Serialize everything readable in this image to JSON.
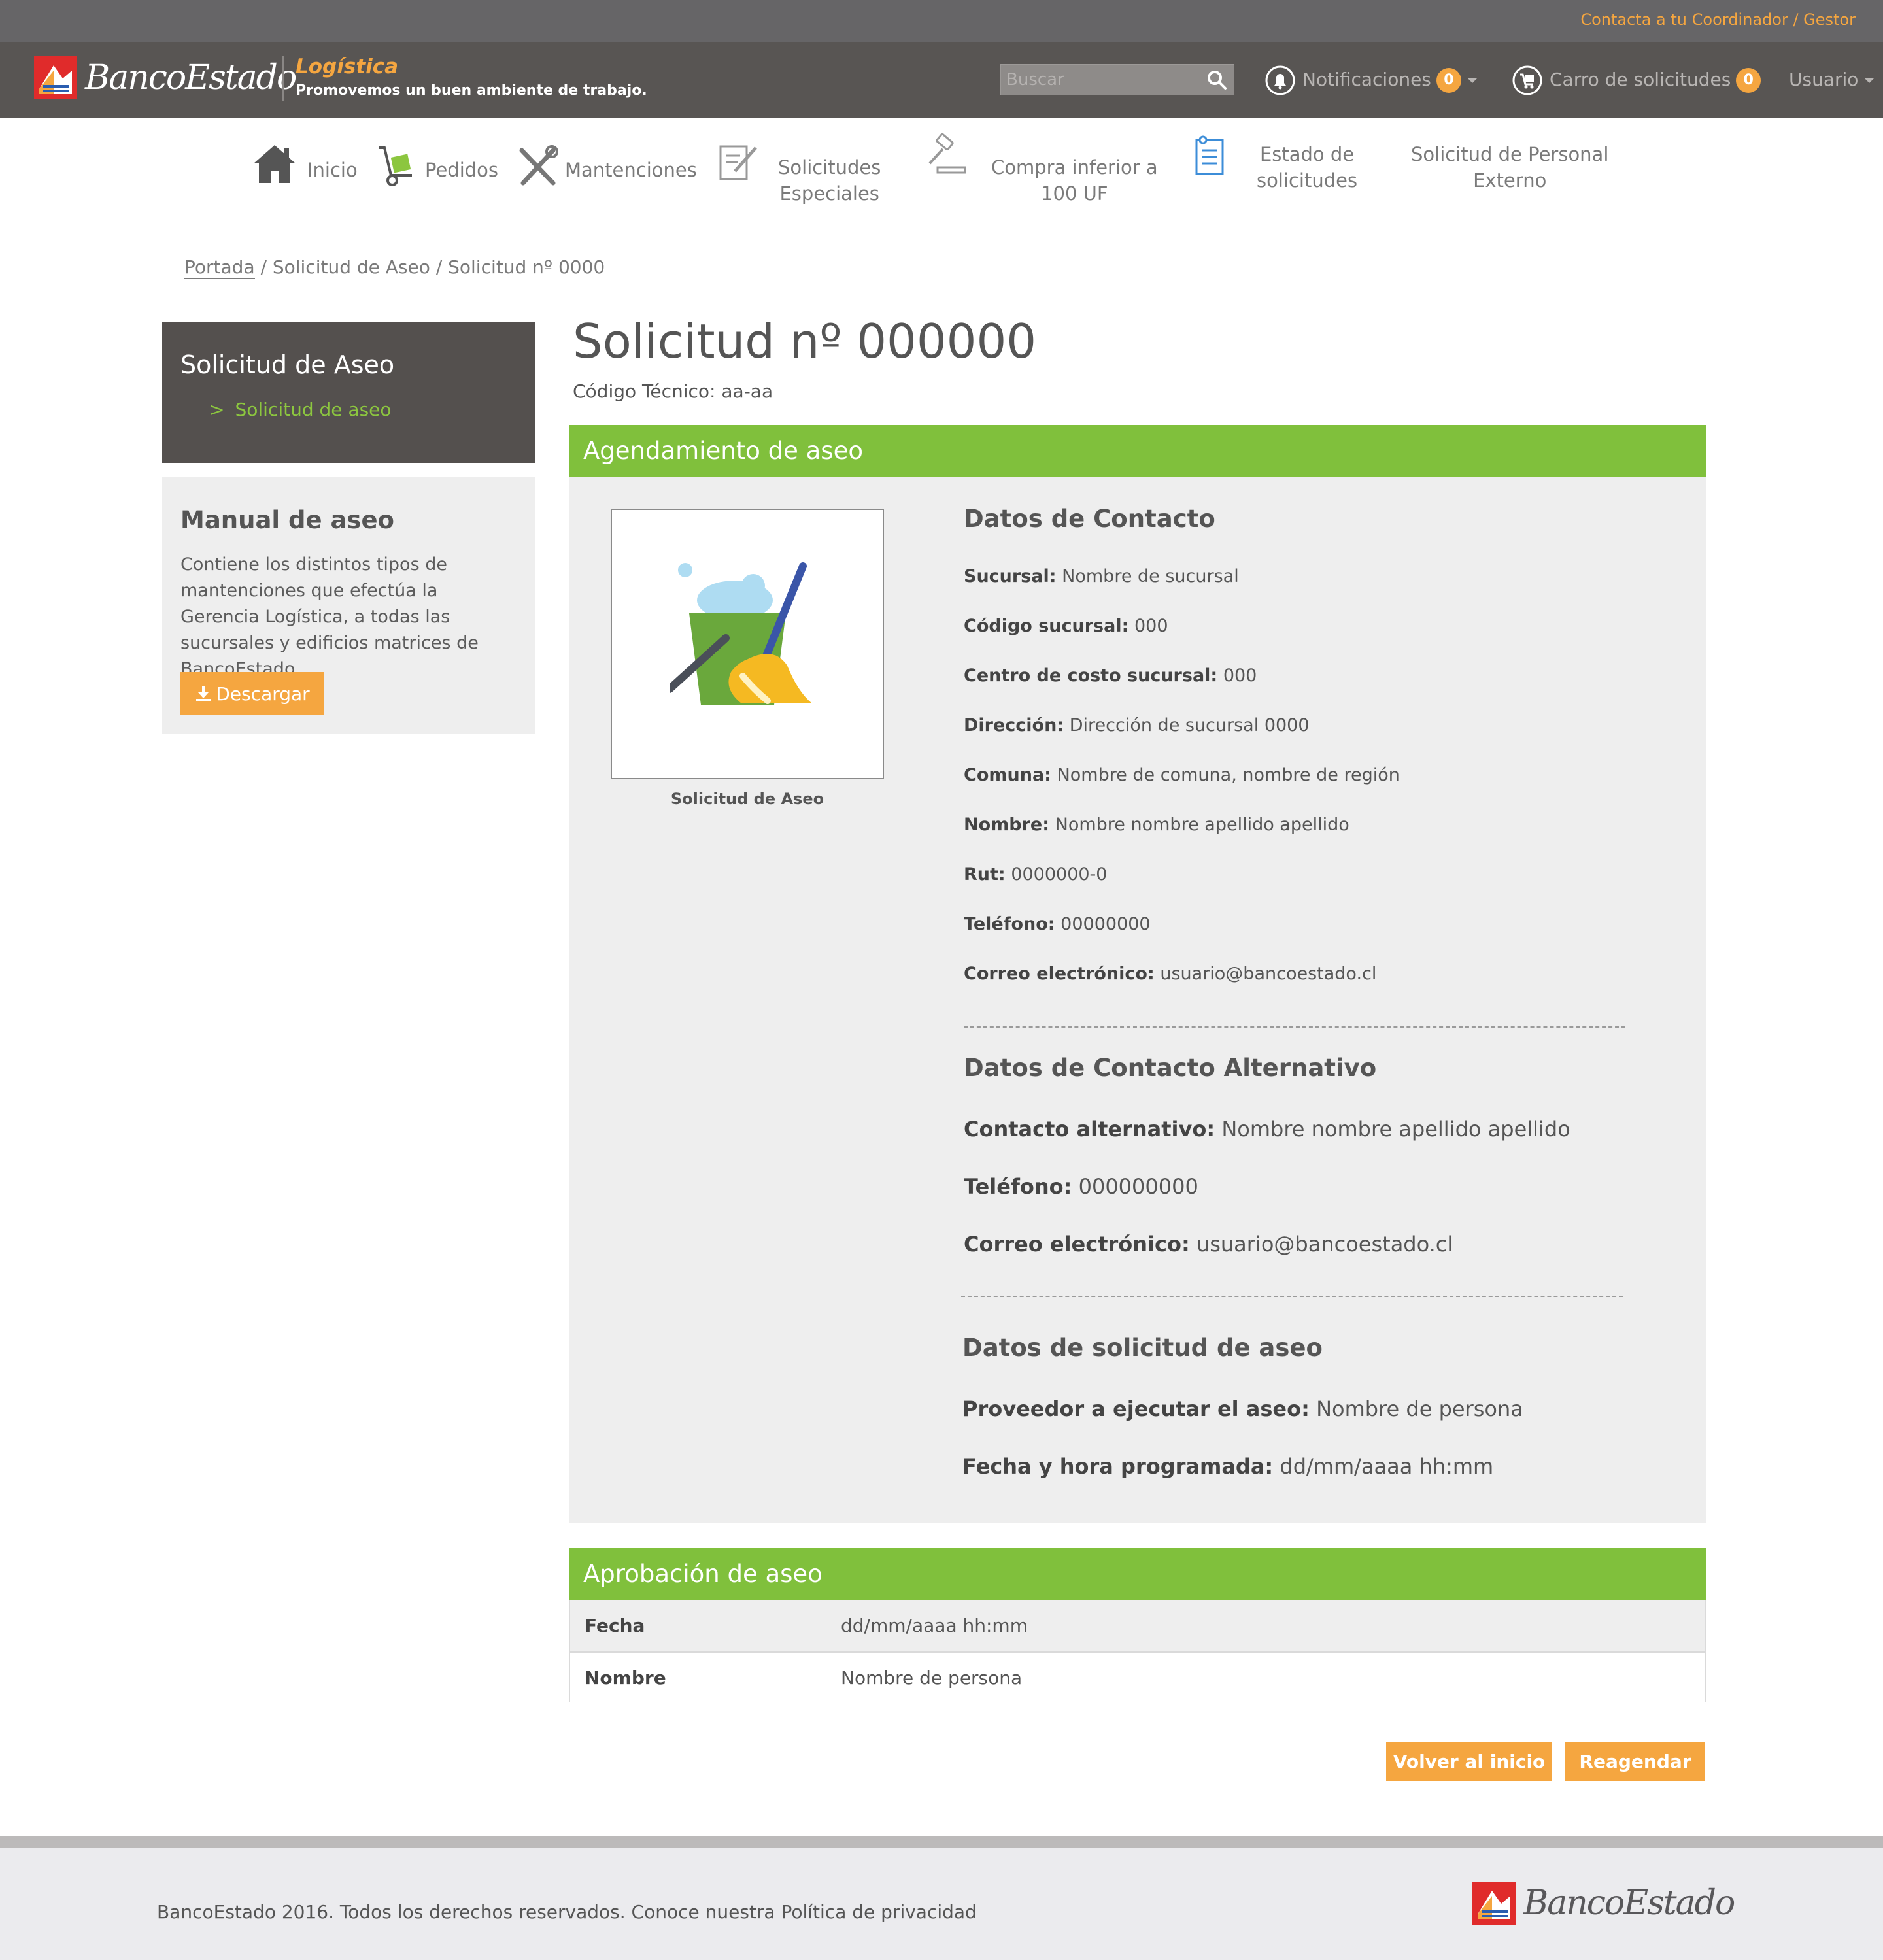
{
  "topbar": {
    "contact_link": "Contacta a tu Coordinador / Gestor"
  },
  "header": {
    "brand": "BancoEstado",
    "section": "Logística",
    "slogan": "Promovemos un buen ambiente de trabajo.",
    "search_placeholder": "Buscar",
    "notifications_label": "Notificaciones",
    "notifications_count": "0",
    "cart_label": "Carro de solicitudes",
    "cart_count": "0",
    "user_label": "Usuario",
    "colors": {
      "bar": "#585553",
      "accent": "#f5a640"
    }
  },
  "nav": {
    "inicio": "Inicio",
    "pedidos": "Pedidos",
    "mantenciones": "Mantenciones",
    "solicitudes_1": "Solicitudes",
    "solicitudes_2": "Especiales",
    "compra_1": "Compra inferior a",
    "compra_2": "100 UF",
    "estado_1": "Estado de",
    "estado_2": "solicitudes",
    "personal_1": "Solicitud de Personal",
    "personal_2": "Externo"
  },
  "breadcrumb": {
    "home": "Portada",
    "rest": " / Solicitud de Aseo / Solicitud nº 0000"
  },
  "sidebar": {
    "menu_title": "Solicitud de Aseo",
    "menu_link_marker": ">",
    "menu_link": "Solicitud de aseo",
    "manual_title": "Manual de aseo",
    "manual_text": "Contiene los distintos tipos de mantenciones que efectúa la Gerencia Logística, a todas las sucursales y edificios matrices de BancoEstado.",
    "download_label": "Descargar"
  },
  "main": {
    "title": "Solicitud nº 000000",
    "code": "Código Técnico: aa-aa",
    "section1_title": "Agendamiento de aseo",
    "image_caption": "Solicitud de Aseo",
    "contact": {
      "heading": "Datos de Contacto",
      "sucursal_k": "Sucursal:",
      "sucursal_v": "Nombre de sucursal",
      "codigo_k": "Código sucursal:",
      "codigo_v": "000",
      "centro_k": "Centro de costo sucursal:",
      "centro_v": "000",
      "direccion_k": "Dirección:",
      "direccion_v": "Dirección de sucursal 0000",
      "comuna_k": "Comuna:",
      "comuna_v": "Nombre de comuna, nombre de región",
      "nombre_k": "Nombre:",
      "nombre_v": "Nombre nombre apellido apellido",
      "rut_k": "Rut:",
      "rut_v": "0000000-0",
      "telefono_k": "Teléfono:",
      "telefono_v": "00000000",
      "correo_k": "Correo electrónico:",
      "correo_v": "usuario@bancoestado.cl"
    },
    "alt_contact": {
      "heading": "Datos de Contacto Alternativo",
      "contacto_k": "Contacto alternativo:",
      "contacto_v": "Nombre nombre apellido apellido",
      "telefono_k": "Teléfono:",
      "telefono_v": "000000000",
      "correo_k": "Correo electrónico:",
      "correo_v": "usuario@bancoestado.cl"
    },
    "aseo": {
      "heading": "Datos de solicitud de aseo",
      "proveedor_k": "Proveedor a ejecutar el aseo:",
      "proveedor_v": "Nombre de persona",
      "fecha_k": "Fecha y hora programada:",
      "fecha_v": "dd/mm/aaaa hh:mm"
    },
    "section2_title": "Aprobación de aseo",
    "approval": {
      "fecha_k": "Fecha",
      "fecha_v": "dd/mm/aaaa hh:mm",
      "nombre_k": "Nombre",
      "nombre_v": "Nombre de persona"
    },
    "btn_back": "Volver al inicio",
    "btn_reschedule": "Reagendar"
  },
  "footer": {
    "copyright": "BancoEstado 2016. Todos los derechos reservados. Conoce nuestra Política de privacidad",
    "brand": "BancoEstado"
  }
}
